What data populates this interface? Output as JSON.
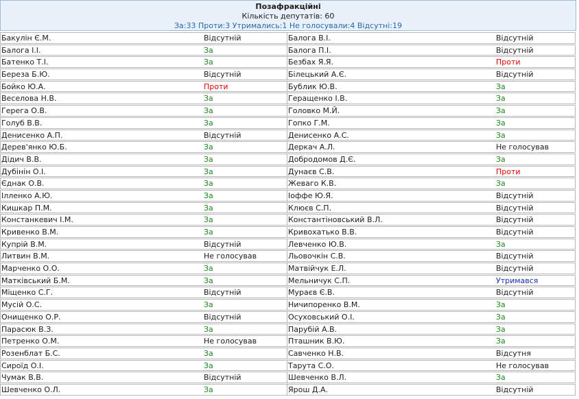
{
  "header": {
    "faction": "Позафракційні",
    "count_text": "Кількість депутатів: 60",
    "summary_text": "За:33 Проти:3 Утримались:1 Не голосували:4 Відсутні:19"
  },
  "colors": {
    "header_bg": "#e9f1fb",
    "header_border": "#9fbad7",
    "summary": "#2a67b0",
    "vote_za": "#1c8a1c",
    "vote_proty": "#e60000",
    "vote_abstain": "#1a2db5"
  },
  "left_column": [
    {
      "name": "Бакулін Є.М.",
      "vote": "Відсутній"
    },
    {
      "name": "Балога І.І.",
      "vote": "За"
    },
    {
      "name": "Батенко Т.І.",
      "vote": "За"
    },
    {
      "name": "Береза Б.Ю.",
      "vote": "Відсутній"
    },
    {
      "name": "Бойко Ю.А.",
      "vote": "Проти"
    },
    {
      "name": "Веселова Н.В.",
      "vote": "За"
    },
    {
      "name": "Герега О.В.",
      "vote": "За"
    },
    {
      "name": "Голуб В.В.",
      "vote": "За"
    },
    {
      "name": "Денисенко А.П.",
      "vote": "Відсутній"
    },
    {
      "name": "Дерев'янко Ю.Б.",
      "vote": "За"
    },
    {
      "name": "Дідич В.В.",
      "vote": "За"
    },
    {
      "name": "Дубінін О.І.",
      "vote": "За"
    },
    {
      "name": "Єднак О.В.",
      "vote": "За"
    },
    {
      "name": "Ілленко А.Ю.",
      "vote": "За"
    },
    {
      "name": "Кишкар П.М.",
      "vote": "За"
    },
    {
      "name": "Констанкевич І.М.",
      "vote": "За"
    },
    {
      "name": "Кривенко В.М.",
      "vote": "За"
    },
    {
      "name": "Купрій В.М.",
      "vote": "Відсутній"
    },
    {
      "name": "Литвин В.М.",
      "vote": "Не голосував"
    },
    {
      "name": "Марченко О.О.",
      "vote": "За"
    },
    {
      "name": "Матківський Б.М.",
      "vote": "За"
    },
    {
      "name": "Міщенко С.Г.",
      "vote": "Відсутній"
    },
    {
      "name": "Мусій О.С.",
      "vote": "За"
    },
    {
      "name": "Онищенко О.Р.",
      "vote": "Відсутній"
    },
    {
      "name": "Парасюк В.З.",
      "vote": "За"
    },
    {
      "name": "Петренко О.М.",
      "vote": "Не голосував"
    },
    {
      "name": "Розенблат Б.С.",
      "vote": "За"
    },
    {
      "name": "Сироїд О.І.",
      "vote": "За"
    },
    {
      "name": "Чумак В.В.",
      "vote": "Відсутній"
    },
    {
      "name": "Шевченко О.Л.",
      "vote": "За"
    }
  ],
  "right_column": [
    {
      "name": "Балога В.І.",
      "vote": "Відсутній"
    },
    {
      "name": "Балога П.І.",
      "vote": "Відсутній"
    },
    {
      "name": "Безбах Я.Я.",
      "vote": "Проти"
    },
    {
      "name": "Білецький А.Є.",
      "vote": "Відсутній"
    },
    {
      "name": "Бублик Ю.В.",
      "vote": "За"
    },
    {
      "name": "Геращенко І.В.",
      "vote": "За"
    },
    {
      "name": "Головко М.Й.",
      "vote": "За"
    },
    {
      "name": "Гопко Г.М.",
      "vote": "За"
    },
    {
      "name": "Денисенко А.С.",
      "vote": "За"
    },
    {
      "name": "Деркач А.Л.",
      "vote": "Не голосував"
    },
    {
      "name": "Добродомов Д.Є.",
      "vote": "За"
    },
    {
      "name": "Дунаєв С.В.",
      "vote": "Проти"
    },
    {
      "name": "Жеваго К.В.",
      "vote": "За"
    },
    {
      "name": "Іоффе Ю.Я.",
      "vote": "Відсутній"
    },
    {
      "name": "Клюєв С.П.",
      "vote": "Відсутній"
    },
    {
      "name": "Константіновський В.Л.",
      "vote": "Відсутній"
    },
    {
      "name": "Кривохатько В.В.",
      "vote": "Відсутній"
    },
    {
      "name": "Левченко Ю.В.",
      "vote": "За"
    },
    {
      "name": "Льовочкін С.В.",
      "vote": "Відсутній"
    },
    {
      "name": "Матвійчук Е.Л.",
      "vote": "Відсутній"
    },
    {
      "name": "Мельничук С.П.",
      "vote": "Утримався"
    },
    {
      "name": "Мураєв Є.В.",
      "vote": "Відсутній"
    },
    {
      "name": "Ничипоренко В.М.",
      "vote": "За"
    },
    {
      "name": "Осуховський О.І.",
      "vote": "За"
    },
    {
      "name": "Парубій А.В.",
      "vote": "За"
    },
    {
      "name": "Пташник В.Ю.",
      "vote": "За"
    },
    {
      "name": "Савченко Н.В.",
      "vote": "Відсутня"
    },
    {
      "name": "Тарута С.О.",
      "vote": "Не голосував"
    },
    {
      "name": "Шевченко В.Л.",
      "vote": "За"
    },
    {
      "name": "Ярош Д.А.",
      "vote": "Відсутній"
    }
  ]
}
